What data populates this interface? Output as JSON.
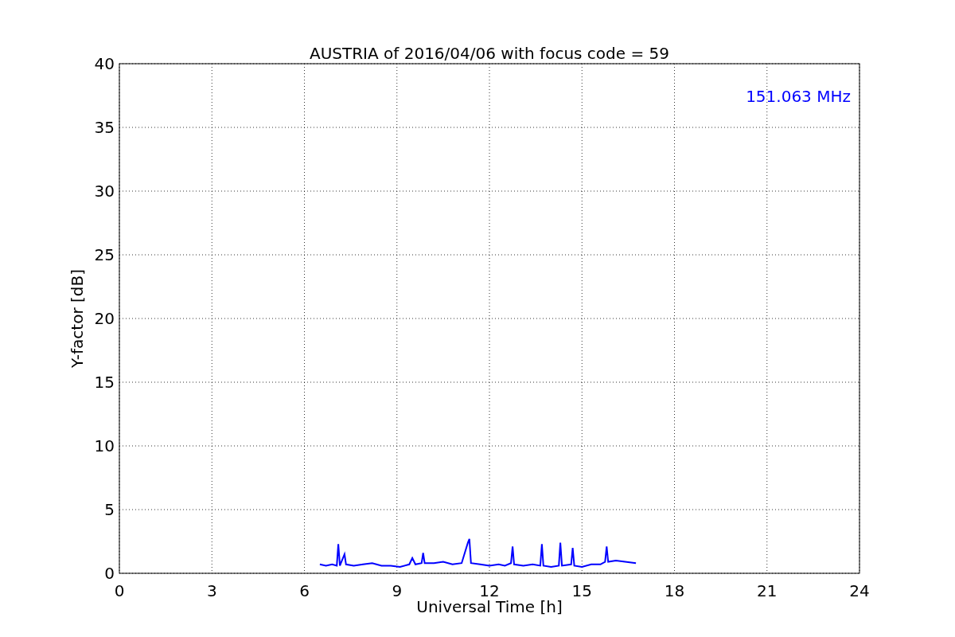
{
  "chart_data": {
    "type": "line",
    "grid": true,
    "title": "AUSTRIA of 2016/04/06 with focus code = 59",
    "xlabel": "Universal Time [h]",
    "ylabel": "Y-factor [dB]",
    "xlim": [
      0,
      24
    ],
    "ylim": [
      0,
      40
    ],
    "xticks": [
      0,
      3,
      6,
      9,
      12,
      15,
      18,
      21,
      24
    ],
    "yticks": [
      0,
      5,
      10,
      15,
      20,
      25,
      30,
      35,
      40
    ],
    "x": [
      6.5,
      6.7,
      6.9,
      7.05,
      7.1,
      7.15,
      7.3,
      7.35,
      7.6,
      7.9,
      8.2,
      8.5,
      8.8,
      9.1,
      9.4,
      9.5,
      9.6,
      9.8,
      9.85,
      9.9,
      10.2,
      10.5,
      10.8,
      11.1,
      11.3,
      11.35,
      11.4,
      11.7,
      12.0,
      12.3,
      12.5,
      12.7,
      12.75,
      12.8,
      13.1,
      13.4,
      13.65,
      13.7,
      13.75,
      14.0,
      14.25,
      14.3,
      14.35,
      14.65,
      14.7,
      14.75,
      15.0,
      15.3,
      15.6,
      15.75,
      15.8,
      15.85,
      16.1,
      16.4,
      16.75
    ],
    "series": [
      {
        "name": "151.063 MHz",
        "color": "#0000ff",
        "values": [
          0.7,
          0.6,
          0.7,
          0.6,
          2.3,
          0.6,
          1.5,
          0.7,
          0.6,
          0.7,
          0.8,
          0.6,
          0.6,
          0.5,
          0.7,
          1.2,
          0.7,
          0.8,
          1.6,
          0.8,
          0.8,
          0.9,
          0.7,
          0.8,
          2.4,
          2.7,
          0.8,
          0.7,
          0.6,
          0.7,
          0.6,
          0.8,
          2.1,
          0.7,
          0.6,
          0.7,
          0.6,
          2.3,
          0.6,
          0.5,
          0.6,
          2.4,
          0.6,
          0.7,
          2.0,
          0.6,
          0.5,
          0.7,
          0.7,
          0.9,
          2.1,
          0.9,
          1.0,
          0.9,
          0.8
        ]
      }
    ]
  }
}
